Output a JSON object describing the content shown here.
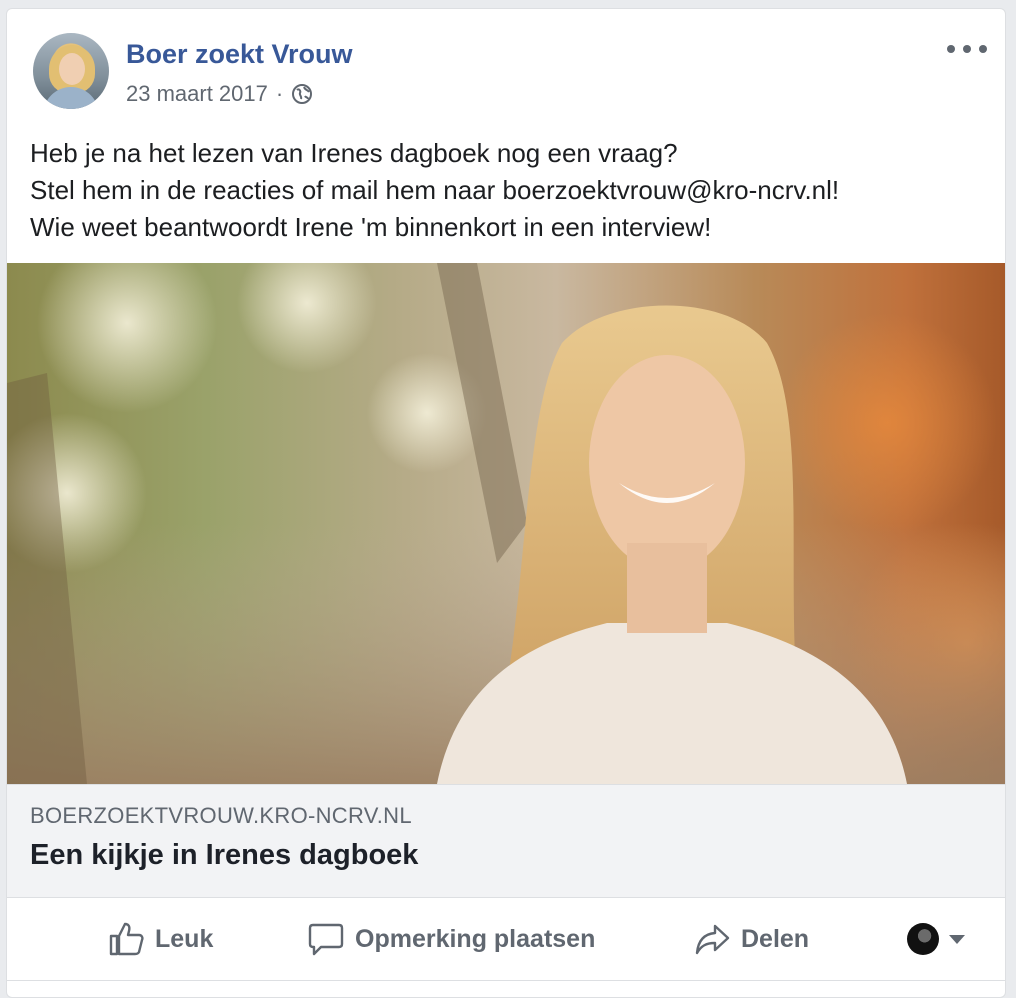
{
  "post": {
    "page_name": "Boer zoekt Vrouw",
    "date": "23 maart 2017",
    "separator": "·",
    "privacy_icon": "globe-icon",
    "text_lines": [
      "Heb je na het lezen van Irenes dagboek nog een vraag?",
      "Stel hem in de reacties of mail hem naar boerzoektvrouw@kro-ncrv.nl!",
      "Wie weet beantwoordt Irene 'm binnenkort in een interview!"
    ]
  },
  "link_preview": {
    "domain": "BOERZOEKTVROUW.KRO-NCRV.NL",
    "title": "Een kijkje in Irenes dagboek"
  },
  "actions": {
    "like_label": "Leuk",
    "comment_label": "Opmerking plaatsen",
    "share_label": "Delen"
  },
  "colors": {
    "page_name": "#385898",
    "secondary_text": "#606770",
    "body_text": "#1c1e21",
    "preview_bg": "#f2f3f5"
  }
}
